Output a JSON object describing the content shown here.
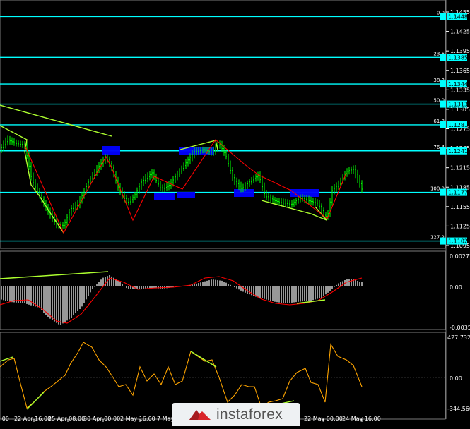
{
  "main_chart": {
    "price_scale": [
      "1.1455",
      "1.1425",
      "1.1395",
      "1.1365",
      "1.1335",
      "1.1305",
      "1.1275",
      "1.1245",
      "1.1215",
      "1.1185",
      "1.1155",
      "1.1125",
      "1.1095"
    ],
    "fib_levels": [
      {
        "ratio": "0.0",
        "price": "1.1448"
      },
      {
        "ratio": "23.6",
        "price": "1.1385"
      },
      {
        "ratio": "38.2",
        "price": "1.1344"
      },
      {
        "ratio": "50.0",
        "price": "1.1313"
      },
      {
        "ratio": "61.8",
        "price": "1.1281"
      },
      {
        "ratio": "76.4",
        "price": "1.1241"
      },
      {
        "ratio": "100.0",
        "price": "1.1177"
      },
      {
        "ratio": "127.2",
        "price": "1.1102"
      }
    ]
  },
  "macd_panel": {
    "top": "0.00277",
    "zero": "0.00",
    "bottom": "-0.0035"
  },
  "osc_panel": {
    "top": "427.7324",
    "zero": "0.00",
    "bottom": "-344.560"
  },
  "time_axis": [
    "22 Apr 16:00",
    "25 Apr 08:00",
    "30 Apr 00:00",
    "2 May 16:00",
    "7 May",
    "22 May 00:00",
    "24 May 16:00"
  ],
  "time_axis_left_fragment": ":00",
  "watermark": {
    "brand": "instaforex"
  },
  "colors": {
    "background": "#000000",
    "fib_line": "#00ffff",
    "label_bg": "#00ffff",
    "highlight": "#0000ff",
    "trend": "#adff2f",
    "signal": "#ff0000",
    "osc": "#ffa500",
    "bars_up": "#00ff00",
    "histogram": "#bfbfbf"
  }
}
